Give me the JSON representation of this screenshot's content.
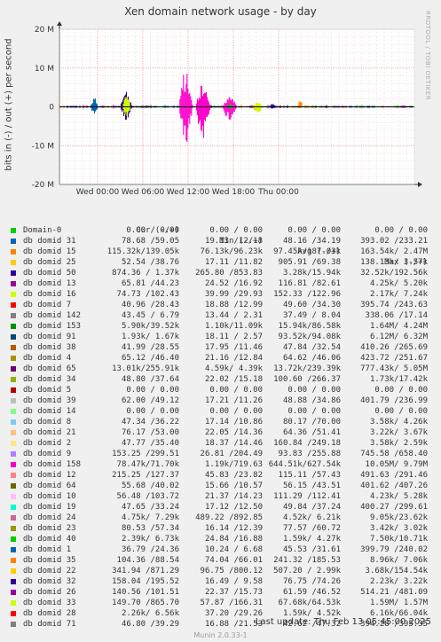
{
  "title": "Xen domain network usage - by day",
  "side_text": "RRDTOOL / TOBI OETIKER",
  "footer": {
    "last_update": "Last update:  Thu Feb 13 05:45:00 2025",
    "version": "Munin 2.0.33-1"
  },
  "chart_data": {
    "type": "area",
    "title": "Xen domain network usage - by day",
    "ylabel": "bits in (-) / out (+) per second",
    "xlabel": "",
    "ylim": [
      -20000000,
      20000000
    ],
    "yticks": [
      {
        "value": 20000000,
        "label": "20 M"
      },
      {
        "value": 10000000,
        "label": "10 M"
      },
      {
        "value": 0,
        "label": "0"
      },
      {
        "value": -10000000,
        "label": "-10 M"
      },
      {
        "value": -20000000,
        "label": "-20 M"
      }
    ],
    "xticks": [
      "Wed 00:00",
      "Wed 06:00",
      "Wed 12:00",
      "Wed 18:00",
      "Thu 00:00"
    ],
    "grid": true,
    "bursts": [
      {
        "series": "db domid 31",
        "color": "#0066b3",
        "start_h": -1.0,
        "end_h": 0.1,
        "peak_out": 2470000,
        "peak_in": -1900000
      },
      {
        "series": "db domid 10",
        "color": "#330099",
        "start_h": 3.0,
        "end_h": 4.6,
        "peak_out": 3900000,
        "peak_in": -3500000
      },
      {
        "series": "db domid 16",
        "color": "#ccff00",
        "start_h": 3.3,
        "end_h": 4.4,
        "peak_out": 3000000,
        "peak_in": -2800000
      },
      {
        "series": "db domid 142",
        "color": "#808080",
        "start_h": 4.8,
        "end_h": 7.8,
        "peak_out": 500000,
        "peak_in": -400000
      },
      {
        "series": "db domid 158",
        "color": "#ff00cc",
        "start_h": 10.8,
        "end_h": 12.6,
        "peak_out": 9790000,
        "peak_in": -10050000
      },
      {
        "series": "db domid 158",
        "color": "#ff00cc",
        "start_h": 13.0,
        "end_h": 15.0,
        "peak_out": 6500000,
        "peak_in": -8500000
      },
      {
        "series": "db domid 158",
        "color": "#ff00cc",
        "start_h": 16.5,
        "end_h": 18.5,
        "peak_out": 2800000,
        "peak_in": -3500000
      },
      {
        "series": "db domid 2",
        "color": "#ffcc00",
        "start_h": 20.5,
        "end_h": 21.8,
        "peak_out": 1500000,
        "peak_in": -1900000
      },
      {
        "series": "db domid 16",
        "color": "#ccff00",
        "start_h": 20.8,
        "end_h": 21.8,
        "peak_out": 1800000,
        "peak_in": -1600000
      },
      {
        "series": "db domid 15",
        "color": "#00cc00",
        "start_h": 17.2,
        "end_h": 18.0,
        "peak_out": 900000,
        "peak_in": -700000
      },
      {
        "series": "db domid 25",
        "color": "#ff8000",
        "start_h": 26.6,
        "end_h": 27.2,
        "peak_out": 2200000,
        "peak_in": -300000
      },
      {
        "series": "db domid 10",
        "color": "#330099",
        "start_h": 22.8,
        "end_h": 23.6,
        "peak_out": 900000,
        "peak_in": -800000
      }
    ],
    "series": [
      {
        "name": "Domain-0",
        "color": "#00cc00",
        "cur": "0.00 / 0.00",
        "min": "0.00 / 0.00",
        "avg": "0.00 / 0.00",
        "max": "0.00 / 0.00"
      },
      {
        "name": "db domid 31",
        "color": "#0066b3",
        "cur": "78.68 /59.05",
        "min": "19.13 /12.18",
        "avg": "48.16 /34.19",
        "max": "393.02 /233.21"
      },
      {
        "name": "db domid 15",
        "color": "#ff8000",
        "cur": "115.32k/139.05k",
        "min": "76.13k/96.23k",
        "avg": "97.45k/187.03k",
        "max": "163.54k/ 2.47M"
      },
      {
        "name": "db domid 25",
        "color": "#ffcc00",
        "cur": "52.54 /38.76",
        "min": "17.11 /11.82",
        "avg": "905.91 /69.38",
        "max": "138.13k/ 3.57k"
      },
      {
        "name": "db domid 50",
        "color": "#330099",
        "cur": "874.36 / 1.37k",
        "min": "265.80 /853.83",
        "avg": "3.28k/15.94k",
        "max": "32.52k/192.56k"
      },
      {
        "name": "db domid 13",
        "color": "#990099",
        "cur": "65.81 /44.23",
        "min": "24.52 /16.92",
        "avg": "116.81 /82.61",
        "max": "4.25k/ 5.20k"
      },
      {
        "name": "db domid 16",
        "color": "#ccff00",
        "cur": "74.73 /102.43",
        "min": "39.99 /29.93",
        "avg": "152.33 /122.96",
        "max": "2.17k/ 7.24k"
      },
      {
        "name": "db domid 7",
        "color": "#ff0000",
        "cur": "40.96 /28.43",
        "min": "18.88 /12.99",
        "avg": "49.60 /34.30",
        "max": "395.74 /243.63"
      },
      {
        "name": "db domid 142",
        "color": "#808080",
        "cur": "43.45 / 6.79",
        "min": "13.44 / 2.31",
        "avg": "37.49 / 8.04",
        "max": "338.06 /17.14"
      },
      {
        "name": "db domid 153",
        "color": "#008f00",
        "cur": "5.90k/39.52k",
        "min": "1.10k/11.09k",
        "avg": "15.94k/86.58k",
        "max": "1.64M/ 4.24M"
      },
      {
        "name": "db domid 91",
        "color": "#00487d",
        "cur": "1.93k/ 1.67k",
        "min": "18.11 / 2.57",
        "avg": "93.52k/94.08k",
        "max": "6.12M/ 6.32M"
      },
      {
        "name": "db domid 38",
        "color": "#b35a00",
        "cur": "41.99 /28.55",
        "min": "17.95 /11.46",
        "avg": "47.84 /32.54",
        "max": "410.26 /265.69"
      },
      {
        "name": "db domid 4",
        "color": "#b38f00",
        "cur": "65.12 /46.40",
        "min": "21.16 /12.84",
        "avg": "64.62 /46.06",
        "max": "423.72 /251.67"
      },
      {
        "name": "db domid 65",
        "color": "#6b006b",
        "cur": "13.01k/255.91k",
        "min": "4.59k/ 4.39k",
        "avg": "13.72k/239.39k",
        "max": "777.43k/ 5.05M"
      },
      {
        "name": "db domid 34",
        "color": "#8fb300",
        "cur": "48.80 /37.64",
        "min": "22.02 /15.18",
        "avg": "100.60 /266.37",
        "max": "1.73k/17.42k"
      },
      {
        "name": "db domid 5",
        "color": "#b30000",
        "cur": "0.00 / 0.00",
        "min": "0.00 / 0.00",
        "avg": "0.00 / 0.00",
        "max": "0.00 / 0.00"
      },
      {
        "name": "db domid 39",
        "color": "#bebebe",
        "cur": "62.00 /49.12",
        "min": "17.21 /11.26",
        "avg": "48.88 /34.86",
        "max": "401.79 /236.99"
      },
      {
        "name": "db domid 14",
        "color": "#80ff80",
        "cur": "0.00 / 0.00",
        "min": "0.00 / 0.00",
        "avg": "0.00 / 0.00",
        "max": "0.00 / 0.00"
      },
      {
        "name": "db domid 8",
        "color": "#80c9ff",
        "cur": "47.34 /36.22",
        "min": "17.14 /10.86",
        "avg": "80.17 /70.00",
        "max": "3.58k/ 4.26k"
      },
      {
        "name": "db domid 21",
        "color": "#ffc080",
        "cur": "76.17 /53.00",
        "min": "22.05 /14.36",
        "avg": "64.36 /51.41",
        "max": "3.22k/ 3.67k"
      },
      {
        "name": "db domid 2",
        "color": "#ffe680",
        "cur": "47.77 /35.40",
        "min": "18.37 /14.46",
        "avg": "160.84 /249.18",
        "max": "3.58k/ 2.59k"
      },
      {
        "name": "db domid 9",
        "color": "#aa80ff",
        "cur": "153.25 /299.51",
        "min": "26.81 /204.49",
        "avg": "93.83 /255.88",
        "max": "745.58 /658.40"
      },
      {
        "name": "db domid 158",
        "color": "#ee00cc",
        "cur": "78.47k/71.70k",
        "min": "1.19k/719.63",
        "avg": "644.51k/627.54k",
        "max": "10.05M/ 9.79M"
      },
      {
        "name": "db domid 12",
        "color": "#ff8080",
        "cur": "215.25 /127.37",
        "min": "45.83 /23.82",
        "avg": "115.11 /57.43",
        "max": "491.63 /291.46"
      },
      {
        "name": "db domid 64",
        "color": "#666600",
        "cur": "55.68 /40.02",
        "min": "15.66 /10.57",
        "avg": "56.15 /43.51",
        "max": "401.62 /407.26"
      },
      {
        "name": "db domid 10",
        "color": "#ffbfff",
        "cur": "56.48 /103.72",
        "min": "21.37 /14.23",
        "avg": "111.29 /112.41",
        "max": "4.23k/ 5.28k"
      },
      {
        "name": "db domid 19",
        "color": "#00ffcc",
        "cur": "47.65 /33.24",
        "min": "17.12 /12.50",
        "avg": "49.84 /37.24",
        "max": "400.27 /299.61"
      },
      {
        "name": "db domid 24",
        "color": "#cc6699",
        "cur": "4.75k/ 7.29k",
        "min": "489.22 /892.85",
        "avg": "4.52k/ 6.21k",
        "max": "9.05k/23.62k"
      },
      {
        "name": "db domid 23",
        "color": "#999900",
        "cur": "80.53 /57.34",
        "min": "16.14 /12.39",
        "avg": "77.57 /60.72",
        "max": "3.42k/ 3.02k"
      },
      {
        "name": "db domid 40",
        "color": "#00cc00",
        "cur": "2.39k/ 6.73k",
        "min": "24.84 /16.88",
        "avg": "1.59k/ 4.27k",
        "max": "7.50k/10.71k"
      },
      {
        "name": "db domid 1",
        "color": "#0066b3",
        "cur": "36.79 /24.36",
        "min": "10.24 / 6.68",
        "avg": "45.53 /31.61",
        "max": "399.79 /240.02"
      },
      {
        "name": "db domid 35",
        "color": "#ff8000",
        "cur": "104.36 /88.54",
        "min": "74.04 /66.01",
        "avg": "241.32 /185.53",
        "max": "8.96k/ 7.06k"
      },
      {
        "name": "db domid 22",
        "color": "#ffcc00",
        "cur": "341.94 /871.29",
        "min": "96.75 /800.12",
        "avg": "507.20 / 2.99k",
        "max": "3.68k/154.54k"
      },
      {
        "name": "db domid 32",
        "color": "#330099",
        "cur": "158.04 /195.52",
        "min": "16.49 / 9.58",
        "avg": "76.75 /74.26",
        "max": "2.23k/ 3.22k"
      },
      {
        "name": "db domid 26",
        "color": "#990099",
        "cur": "140.56 /101.51",
        "min": "22.37 /15.73",
        "avg": "61.59 /46.52",
        "max": "514.21 /481.09"
      },
      {
        "name": "db domid 33",
        "color": "#ccff00",
        "cur": "149.70 /865.70",
        "min": "57.87 /166.31",
        "avg": "67.68k/64.53k",
        "max": "1.59M/ 1.57M"
      },
      {
        "name": "db domid 28",
        "color": "#ff0000",
        "cur": "2.26k/ 6.56k",
        "min": "37.20 /29.26",
        "avg": "1.59k/ 4.52k",
        "max": "6.16k/66.04k"
      },
      {
        "name": "db domid 71",
        "color": "#808080",
        "cur": "46.80 /39.29",
        "min": "16.88 /21.53",
        "avg": "42.62 /47.32",
        "max": "394.28 /395.35"
      }
    ],
    "legend_headers": {
      "cur": "Cur (-/+)",
      "min": "Min (-/+)",
      "avg": "Avg (-/+)",
      "max": "Max (-/+)"
    }
  }
}
